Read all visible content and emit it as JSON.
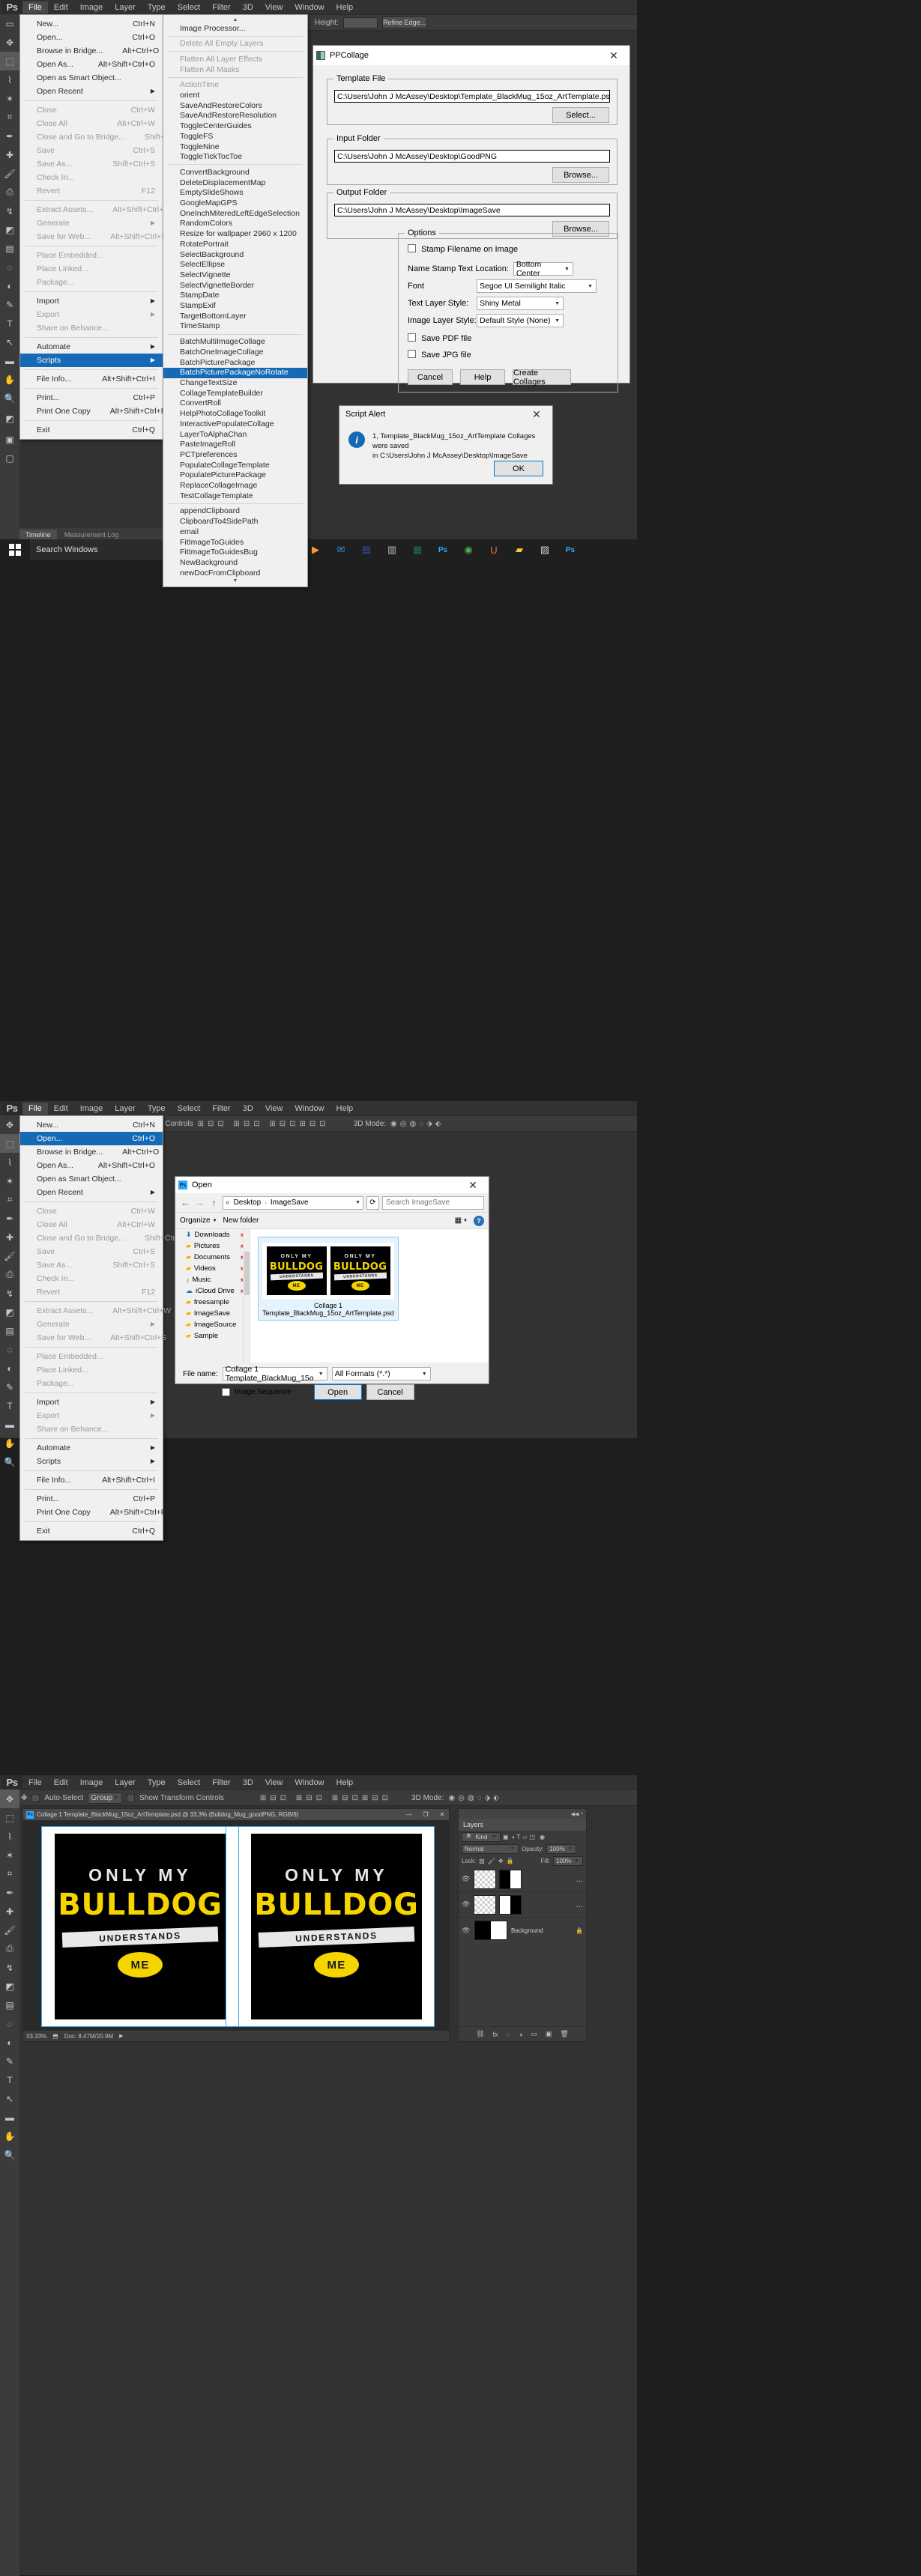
{
  "app": {
    "name": "Ps",
    "logo": "Ps"
  },
  "menubar": {
    "items": [
      "File",
      "Edit",
      "Image",
      "Layer",
      "Type",
      "Select",
      "Filter",
      "3D",
      "View",
      "Window",
      "Help"
    ],
    "active": "File"
  },
  "file_menu": {
    "items": [
      {
        "label": "New...",
        "accel": "Ctrl+N",
        "dim": false
      },
      {
        "label": "Open...",
        "accel": "Ctrl+O",
        "dim": false
      },
      {
        "label": "Browse in Bridge...",
        "accel": "Alt+Ctrl+O",
        "dim": false
      },
      {
        "label": "Open As...",
        "accel": "Alt+Shift+Ctrl+O",
        "dim": false
      },
      {
        "label": "Open as Smart Object...",
        "accel": "",
        "dim": false
      },
      {
        "label": "Open Recent",
        "accel": "",
        "sub": true,
        "dim": false
      },
      {
        "sep": true
      },
      {
        "label": "Close",
        "accel": "Ctrl+W",
        "dim": true
      },
      {
        "label": "Close All",
        "accel": "Alt+Ctrl+W",
        "dim": true
      },
      {
        "label": "Close and Go to Bridge...",
        "accel": "Shift+Ctrl+W",
        "dim": true
      },
      {
        "label": "Save",
        "accel": "Ctrl+S",
        "dim": true
      },
      {
        "label": "Save As...",
        "accel": "Shift+Ctrl+S",
        "dim": true
      },
      {
        "label": "Check In...",
        "accel": "",
        "dim": true
      },
      {
        "label": "Revert",
        "accel": "F12",
        "dim": true
      },
      {
        "sep": true
      },
      {
        "label": "Extract Assets...",
        "accel": "Alt+Shift+Ctrl+W",
        "dim": true
      },
      {
        "label": "Generate",
        "accel": "",
        "sub": true,
        "dim": true
      },
      {
        "label": "Save for Web...",
        "accel": "Alt+Shift+Ctrl+S",
        "dim": true
      },
      {
        "sep": true
      },
      {
        "label": "Place Embedded...",
        "accel": "",
        "dim": true
      },
      {
        "label": "Place Linked...",
        "accel": "",
        "dim": true
      },
      {
        "label": "Package...",
        "accel": "",
        "dim": true
      },
      {
        "sep": true
      },
      {
        "label": "Import",
        "accel": "",
        "sub": true,
        "dim": false
      },
      {
        "label": "Export",
        "accel": "",
        "sub": true,
        "dim": true
      },
      {
        "label": "Share on Behance...",
        "accel": "",
        "dim": true
      },
      {
        "sep": true
      },
      {
        "label": "Automate",
        "accel": "",
        "sub": true,
        "dim": false
      },
      {
        "label": "Scripts",
        "accel": "",
        "sub": true,
        "dim": false,
        "highlight": true
      },
      {
        "sep": true
      },
      {
        "label": "File Info...",
        "accel": "Alt+Shift+Ctrl+I",
        "dim": false
      },
      {
        "sep": true
      },
      {
        "label": "Print...",
        "accel": "Ctrl+P",
        "dim": false
      },
      {
        "label": "Print One Copy",
        "accel": "Alt+Shift+Ctrl+P",
        "dim": false
      },
      {
        "sep": true
      },
      {
        "label": "Exit",
        "accel": "Ctrl+Q",
        "dim": false
      }
    ]
  },
  "file_menu2": {
    "items": [
      {
        "label": "New...",
        "accel": "Ctrl+N",
        "dim": false
      },
      {
        "label": "Open...",
        "accel": "Ctrl+O",
        "dim": false,
        "highlight": true
      },
      {
        "label": "Browse in Bridge...",
        "accel": "Alt+Ctrl+O",
        "dim": false
      },
      {
        "label": "Open As...",
        "accel": "Alt+Shift+Ctrl+O",
        "dim": false
      },
      {
        "label": "Open as Smart Object...",
        "accel": "",
        "dim": false
      },
      {
        "label": "Open Recent",
        "accel": "",
        "sub": true,
        "dim": false
      },
      {
        "sep": true
      },
      {
        "label": "Close",
        "accel": "Ctrl+W",
        "dim": true
      },
      {
        "label": "Close All",
        "accel": "Alt+Ctrl+W",
        "dim": true
      },
      {
        "label": "Close and Go to Bridge...",
        "accel": "Shift+Ctrl+W",
        "dim": true
      },
      {
        "label": "Save",
        "accel": "Ctrl+S",
        "dim": true
      },
      {
        "label": "Save As...",
        "accel": "Shift+Ctrl+S",
        "dim": true
      },
      {
        "label": "Check In...",
        "accel": "",
        "dim": true
      },
      {
        "label": "Revert",
        "accel": "F12",
        "dim": true
      },
      {
        "sep": true
      },
      {
        "label": "Extract Assets...",
        "accel": "Alt+Shift+Ctrl+W",
        "dim": true
      },
      {
        "label": "Generate",
        "accel": "",
        "sub": true,
        "dim": true
      },
      {
        "label": "Save for Web...",
        "accel": "Alt+Shift+Ctrl+S",
        "dim": true
      },
      {
        "sep": true
      },
      {
        "label": "Place Embedded...",
        "accel": "",
        "dim": true
      },
      {
        "label": "Place Linked...",
        "accel": "",
        "dim": true
      },
      {
        "label": "Package...",
        "accel": "",
        "dim": true
      },
      {
        "sep": true
      },
      {
        "label": "Import",
        "accel": "",
        "sub": true,
        "dim": false
      },
      {
        "label": "Export",
        "accel": "",
        "sub": true,
        "dim": true
      },
      {
        "label": "Share on Behance...",
        "accel": "",
        "dim": true
      },
      {
        "sep": true
      },
      {
        "label": "Automate",
        "accel": "",
        "sub": true,
        "dim": false
      },
      {
        "label": "Scripts",
        "accel": "",
        "sub": true,
        "dim": false
      },
      {
        "sep": true
      },
      {
        "label": "File Info...",
        "accel": "Alt+Shift+Ctrl+I",
        "dim": false
      },
      {
        "sep": true
      },
      {
        "label": "Print...",
        "accel": "Ctrl+P",
        "dim": false
      },
      {
        "label": "Print One Copy",
        "accel": "Alt+Shift+Ctrl+P",
        "dim": false
      },
      {
        "sep": true
      },
      {
        "label": "Exit",
        "accel": "Ctrl+Q",
        "dim": false
      }
    ]
  },
  "scripts_menu": {
    "scroll_up": "▲",
    "scroll_down": "▼",
    "items": [
      {
        "label": "Image Processor...",
        "dim": false
      },
      {
        "sep": true
      },
      {
        "label": "Delete All Empty Layers",
        "dim": true
      },
      {
        "sep": true
      },
      {
        "label": "Flatten All Layer Effects",
        "dim": true
      },
      {
        "label": "Flatten All Masks",
        "dim": true
      },
      {
        "sep": true
      },
      {
        "label": "ActionTime",
        "dim": true
      },
      {
        "label": "orient",
        "dim": false
      },
      {
        "label": "SaveAndRestoreColors",
        "dim": false
      },
      {
        "label": "SaveAndRestoreResolution",
        "dim": false
      },
      {
        "label": "ToggleCenterGuides",
        "dim": false
      },
      {
        "label": "ToggleFS",
        "dim": false
      },
      {
        "label": "ToggleNine",
        "dim": false
      },
      {
        "label": "ToggleTickTocToe",
        "dim": false
      },
      {
        "sep": true
      },
      {
        "label": "ConvertBackground",
        "dim": false
      },
      {
        "label": "DeleteDisplacementMap",
        "dim": false
      },
      {
        "label": "EmptySlideShows",
        "dim": false
      },
      {
        "label": "GoogleMapGPS",
        "dim": false
      },
      {
        "label": "OneInchMiteredLeftEdgeSelection",
        "dim": false
      },
      {
        "label": "RandomColors",
        "dim": false
      },
      {
        "label": "Resize for wallpaper 2960 x 1200",
        "dim": false
      },
      {
        "label": "RotatePortrait",
        "dim": false
      },
      {
        "label": "SelectBackground",
        "dim": false
      },
      {
        "label": "SelectEllipse",
        "dim": false
      },
      {
        "label": "SelectVignette",
        "dim": false
      },
      {
        "label": "SelectVignetteBorder",
        "dim": false
      },
      {
        "label": "StampDate",
        "dim": false
      },
      {
        "label": "StampExif",
        "dim": false
      },
      {
        "label": "TargetBottomLayer",
        "dim": false
      },
      {
        "label": "TimeStamp",
        "dim": false
      },
      {
        "sep": true
      },
      {
        "label": "BatchMultiImageCollage",
        "dim": false
      },
      {
        "label": "BatchOneImageCollage",
        "dim": false
      },
      {
        "label": "BatchPicturePackage",
        "dim": false
      },
      {
        "label": "BatchPicturePackageNoRotate",
        "dim": false,
        "highlight": true
      },
      {
        "label": "ChangeTextSize",
        "dim": false
      },
      {
        "label": "CollageTemplateBuilder",
        "dim": false
      },
      {
        "label": "ConvertRoll",
        "dim": false
      },
      {
        "label": "HelpPhotoCollageToolkit",
        "dim": false
      },
      {
        "label": "InteractivePopulateCollage",
        "dim": false
      },
      {
        "label": "LayerToAlphaChan",
        "dim": false
      },
      {
        "label": "PasteImageRoll",
        "dim": false
      },
      {
        "label": "PCTpreferences",
        "dim": false
      },
      {
        "label": "PopulateCollageTemplate",
        "dim": false
      },
      {
        "label": "PopulatePicturePackage",
        "dim": false
      },
      {
        "label": "ReplaceCollageImage",
        "dim": false
      },
      {
        "label": "TestCollageTemplate",
        "dim": false
      },
      {
        "sep": true
      },
      {
        "label": "appendClipboard",
        "dim": false
      },
      {
        "label": "ClipboardTo4SidePath",
        "dim": false
      },
      {
        "label": "email",
        "dim": false
      },
      {
        "label": "FitImageToGuides",
        "dim": false
      },
      {
        "label": "FitImageToGuidesBug",
        "dim": false
      },
      {
        "label": "NewBackground",
        "dim": false
      },
      {
        "label": "newDocFromClipboard",
        "dim": false
      }
    ]
  },
  "ppcollage": {
    "title": "PPCollage",
    "close_label": "✕",
    "template_group": "Template File",
    "template_value": "C:\\Users\\John J McAssey\\Desktop\\Template_BlackMug_15oz_ArtTemplate.psd",
    "template_button": "Select...",
    "input_group": "Input Folder",
    "input_value": "C:\\Users\\John J McAssey\\Desktop\\GoodPNG",
    "input_button": "Browse...",
    "output_group": "Output Folder",
    "output_value": "C:\\Users\\John J McAssey\\Desktop\\ImageSave",
    "output_button": "Browse...",
    "options_group": "Options",
    "stamp_filename_label": "Stamp Filename on Image",
    "stamp_location_label": "Name Stamp Text Location:",
    "stamp_location_value": "Bottom Center",
    "font_label": "Font",
    "font_value": "Segoe UI Semilight Italic",
    "text_layer_style_label": "Text Layer Style:",
    "text_layer_style_value": "Shiny Metal",
    "image_layer_style_label": "Image Layer Style:",
    "image_layer_style_value": "Default Style (None)",
    "save_pdf_label": "Save PDF file",
    "save_jpg_label": "Save JPG file",
    "cancel_button": "Cancel",
    "help_button": "Help",
    "create_button": "Create Collages"
  },
  "script_alert": {
    "title": "Script Alert",
    "close_label": "✕",
    "icon": "info-icon",
    "message_line1": "1, Template_BlackMug_15oz_ArtTemplate Collages were saved",
    "message_line2": "in C:\\Users\\John J McAssey\\Desktop\\ImageSave",
    "ok_button": "OK"
  },
  "taskbar": {
    "start_icon": "windows-start-icon",
    "search_placeholder": "Search Windows",
    "icons": [
      "store-icon",
      "video-icon",
      "mail-icon",
      "word-icon",
      "calculator-icon",
      "excel-icon",
      "photoshop-icon",
      "chrome-icon",
      "uc-icon",
      "folder-icon",
      "paint-icon",
      "photoshop-icon-2"
    ]
  },
  "timeline_tabs": {
    "items": [
      "Timeline",
      "Measurement Log"
    ]
  },
  "options_bar1": {
    "height_label": "Height:",
    "height_value": "",
    "refine_label": "Refine Edge..."
  },
  "options_bar2": {
    "controls_label": "n Controls",
    "mode_label": "3D Mode:"
  },
  "options_bar3": {
    "auto_select": "Auto-Select",
    "group_value": "Group",
    "show_transform": "Show Transform Controls",
    "mode_label": "3D Mode:"
  },
  "open_dialog": {
    "title": "Open",
    "close_label": "✕",
    "nav": {
      "back": "←",
      "forward": "→",
      "up": "↑"
    },
    "breadcrumb_prefix": "«",
    "breadcrumb": [
      "Desktop",
      "ImageSave"
    ],
    "refresh_icon": "refresh-icon",
    "search_placeholder": "Search ImageSave",
    "organize_label": "Organize",
    "newfolder_label": "New folder",
    "view_icon": "view-icon",
    "help_icon": "help-icon",
    "sidebar": [
      {
        "label": "Downloads",
        "icon": "download-icon",
        "pinned": true
      },
      {
        "label": "Pictures",
        "icon": "folder-icon",
        "pinned": true
      },
      {
        "label": "Documents",
        "icon": "folder-icon",
        "pinned": true
      },
      {
        "label": "Videos",
        "icon": "folder-icon",
        "pinned": true
      },
      {
        "label": "Music",
        "icon": "music-icon",
        "pinned": true
      },
      {
        "label": "iCloud Drive",
        "icon": "cloud-icon",
        "pinned": true
      },
      {
        "label": "freesample",
        "icon": "folder-icon",
        "pinned": false
      },
      {
        "label": "ImageSave",
        "icon": "folder-icon",
        "pinned": false
      },
      {
        "label": "ImageSource",
        "icon": "folder-icon",
        "pinned": false
      },
      {
        "label": "Sample",
        "icon": "folder-icon",
        "pinned": false
      }
    ],
    "file_item": {
      "name_line1": "Collage 1",
      "name_line2": "Template_BlackMug_15oz_ArtTemplate.psd",
      "selected": true
    },
    "filename_label": "File name:",
    "filename_value": "Collage 1 Template_BlackMug_15o",
    "filetype_value": "All Formats (*.*)",
    "image_sequence_label": "Image Sequence",
    "open_button": "Open",
    "cancel_button": "Cancel"
  },
  "document": {
    "tab_title": "Collage 1 Template_BlackMug_15oz_ArtTemplate.psd @ 33.3% (Bulldog_Mug_goodPNG, RGB/8)",
    "minimize": "—",
    "maximize": "❐",
    "close": "✕",
    "zoom_status": "33.33%",
    "doc_status": "Doc: 8.47M/20.9M"
  },
  "layers_panel": {
    "title": "Layers",
    "collapse_icons": "«  ▪",
    "kind_label": "Kind",
    "blend_mode": "Normal",
    "opacity_label": "Opacity:",
    "opacity_value": "100%",
    "lock_label": "Lock:",
    "fill_label": "Fill:",
    "fill_value": "100%",
    "rows": [
      {
        "name": "",
        "thumb": "checker",
        "mask": "black-white",
        "visible": true,
        "more": "..."
      },
      {
        "name": "",
        "thumb": "checker",
        "mask": "white-black",
        "visible": true,
        "more": "..."
      },
      {
        "name": "Background",
        "thumb": "black-white",
        "locked": true,
        "visible": true
      }
    ],
    "bottom_icons": [
      "link-icon",
      "fx-icon",
      "mask-icon",
      "adjustment-icon",
      "group-icon",
      "new-layer-icon",
      "delete-icon"
    ]
  },
  "artwork": {
    "line1": "ONLY MY",
    "line2": "BULLDOG",
    "banner": "UNDERSTANDS",
    "badge": "ME",
    "bg_color": "#000000",
    "accent_color": "#f5d400",
    "text_color": "#e8e8e8"
  }
}
